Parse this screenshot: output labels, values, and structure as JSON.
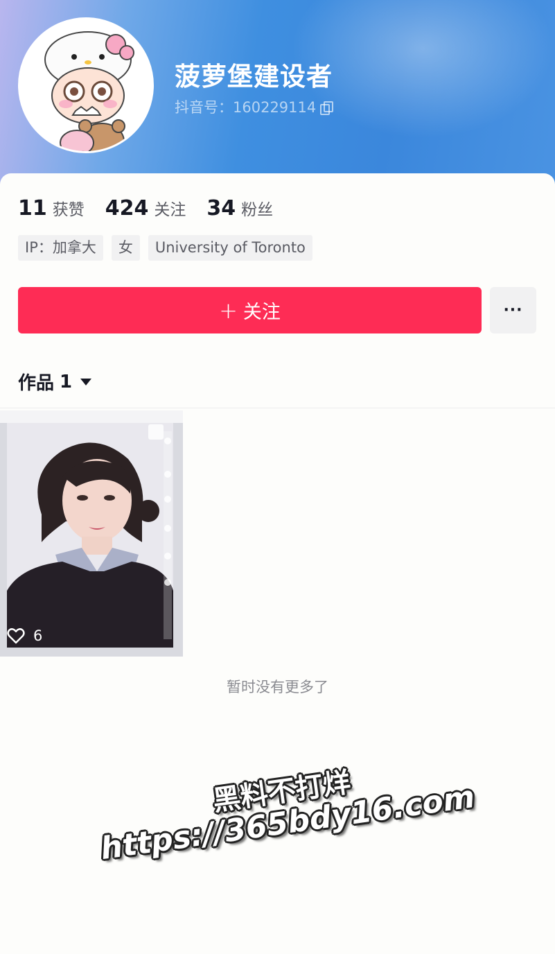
{
  "profile": {
    "name": "菠萝堡建设者",
    "douyin_id": "抖音号：160229114"
  },
  "stats": [
    {
      "value": "11",
      "label": "获赞"
    },
    {
      "value": "424",
      "label": "关注"
    },
    {
      "value": "34",
      "label": "粉丝"
    }
  ],
  "tags": [
    "IP：加拿大",
    "女",
    "University of Toronto"
  ],
  "actions": {
    "follow_plus": "+",
    "follow_label": "关注",
    "more_label": "···"
  },
  "works": {
    "label": "作品",
    "count": "1"
  },
  "video": {
    "likes": "6"
  },
  "footer": {
    "no_more": "暂时没有更多了"
  },
  "watermark": {
    "line1": "黑料不打烊",
    "line2": "https://365bdy16.com"
  },
  "colors": {
    "follow_button": "#fe2c55",
    "header_gradient_start": "#b9b6ee",
    "header_gradient_end": "#3b87dc"
  }
}
